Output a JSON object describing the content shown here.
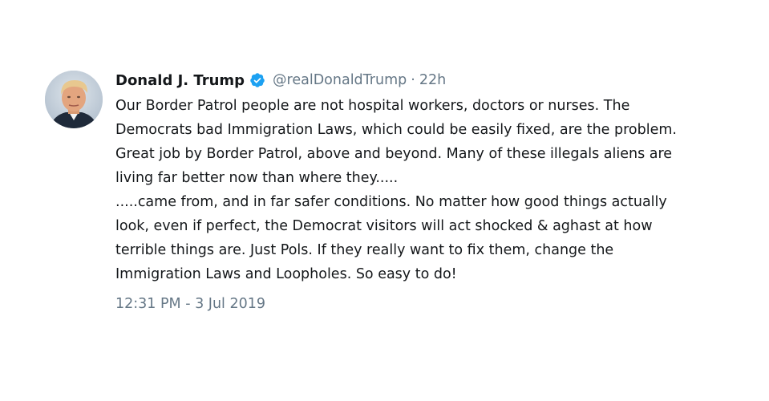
{
  "tweet": {
    "author": {
      "name": "Donald J. Trump",
      "handle": "@realDonaldTrump",
      "verified": true,
      "avatar_icon": "profile-photo"
    },
    "separator": "·",
    "time_ago": "22h",
    "lines": [
      "Our Border Patrol people are not hospital workers, doctors or nurses. The",
      "Democrats bad Immigration Laws, which could be easily fixed, are the problem.",
      "Great job by Border Patrol, above and beyond. Many of these illegals aliens are",
      "living far better now than where they.....",
      ".....came from, and in far safer conditions. No matter how good things actually",
      "look, even if perfect, the Democrat visitors will act shocked & aghast at how",
      "terrible things are. Just Pols. If they really want to fix them, change the",
      "Immigration Laws and Loopholes. So easy to do!"
    ],
    "timestamp": "12:31 PM - 3 Jul 2019",
    "colors": {
      "verified_badge": "#1da1f2",
      "secondary_text": "#657786",
      "primary_text": "#14171a"
    }
  }
}
